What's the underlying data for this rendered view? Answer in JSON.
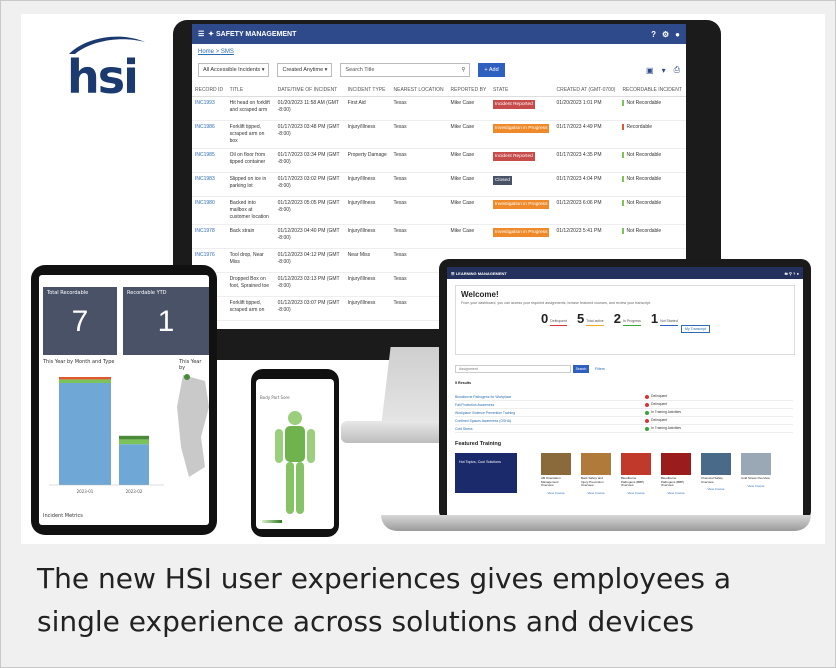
{
  "caption": "The new HSI user experiences gives employees a single experience across solutions and devices",
  "logo": {
    "text": "hsi"
  },
  "colors": {
    "brand_navy": "#1a3a70",
    "header_blue": "#2f4a8a",
    "link_blue": "#2b6cb0",
    "red": "#c84b4b",
    "orange": "#ef8a2a",
    "dark": "#4a5268",
    "green": "#7cc35a"
  },
  "monitor": {
    "app_title": "SAFETY MANAGEMENT",
    "breadcrumb": [
      "Home",
      "SMS"
    ],
    "filter_incidents": "All Accessible Incidents ▾",
    "filter_created": "Created Anytime ▾",
    "search_placeholder": "Search Title",
    "add_label": "+ Add",
    "columns": [
      "RECORD ID",
      "TITLE",
      "DATE/TIME OF INCIDENT",
      "INCIDENT TYPE",
      "NEAREST LOCATION",
      "REPORTED BY",
      "STATE",
      "CREATED AT (GMT-0700)",
      "RECORDABLE INCIDENT"
    ],
    "rows": [
      {
        "id": "INC1993",
        "title": "Hit head on forklift and scraped arm",
        "date": "01/20/2023 11:58 AM (GMT -8:00)",
        "type": "First Aid",
        "loc": "Texas",
        "by": "Mike Case",
        "state": "Incident Reported",
        "state_color": "#c84b4b",
        "created": "01/20/2023 1:01 PM",
        "rec": "Not Recordable"
      },
      {
        "id": "INC1986",
        "title": "Forklift tipped, scraped arm on box",
        "date": "01/17/2023 03:48 PM (GMT -8:00)",
        "type": "Injury/Illness",
        "loc": "Texas",
        "by": "Mike Case",
        "state": "Investigation in Progress",
        "state_color": "#ef8a2a",
        "created": "01/17/2023 4:49 PM",
        "rec": "Recordable"
      },
      {
        "id": "INC1985",
        "title": "Oil on floor from tipped container",
        "date": "01/17/2023 03:34 PM (GMT -8:00)",
        "type": "Property Damage",
        "loc": "Texas",
        "by": "Mike Case",
        "state": "Incident Reported",
        "state_color": "#c84b4b",
        "created": "01/17/2023 4:35 PM",
        "rec": "Not Recordable"
      },
      {
        "id": "INC1983",
        "title": "Slipped on ice in parking lot",
        "date": "01/17/2023 03:02 PM (GMT -8:00)",
        "type": "Injury/Illness",
        "loc": "Texas",
        "by": "Mike Case",
        "state": "Closed",
        "state_color": "#4a5268",
        "created": "01/17/2023 4:04 PM",
        "rec": "Not Recordable"
      },
      {
        "id": "INC1980",
        "title": "Backed into mailbox at customer location",
        "date": "01/12/2023 05:05 PM (GMT -8:00)",
        "type": "Injury/Illness",
        "loc": "Texas",
        "by": "Mike Case",
        "state": "Investigation in Progress",
        "state_color": "#ef8a2a",
        "created": "01/12/2023 6:06 PM",
        "rec": "Not Recordable"
      },
      {
        "id": "INC1978",
        "title": "Back strain",
        "date": "01/12/2023 04:40 PM (GMT -8:00)",
        "type": "Injury/Illness",
        "loc": "Texas",
        "by": "Mike Case",
        "state": "Investigation in Progress",
        "state_color": "#ef8a2a",
        "created": "01/12/2023 5:41 PM",
        "rec": "Not Recordable"
      },
      {
        "id": "INC1976",
        "title": "Tool drop, Near Miss",
        "date": "01/12/2023 04:12 PM (GMT -8:00)",
        "type": "Near Miss",
        "loc": "Texas",
        "by": "",
        "state": "",
        "state_color": "#ffffff",
        "created": "",
        "rec": ""
      },
      {
        "id": "74",
        "title": "Dropped Box on foot, Sprained toe",
        "date": "01/12/2023 03:13 PM (GMT -8:00)",
        "type": "Injury/Illness",
        "loc": "Texas",
        "by": "",
        "state": "",
        "state_color": "#ffffff",
        "created": "",
        "rec": ""
      },
      {
        "id": "73",
        "title": "Forklift tipped, scraped arm on",
        "date": "01/12/2023 03:07 PM (GMT -8:00)",
        "type": "Injury/Illness",
        "loc": "Texas",
        "by": "",
        "state": "",
        "state_color": "#ffffff",
        "created": "",
        "rec": ""
      }
    ]
  },
  "tablet": {
    "tile1_label": "Total Recordable",
    "tile1_value": "7",
    "tile2_label": "Recordable YTD",
    "tile2_value": "1",
    "chart_title": "This Year by Month and Type",
    "chart2_title": "This Year by",
    "footer": "Incident Metrics",
    "bars": [
      {
        "category": "2023-01",
        "segments": [
          {
            "value": 85,
            "color": "#6fa8d6"
          },
          {
            "value": 3,
            "color": "#7cc35a"
          },
          {
            "value": 2,
            "color": "#e3582f"
          }
        ]
      },
      {
        "category": "2023-02",
        "segments": [
          {
            "value": 34,
            "color": "#6fa8d6"
          },
          {
            "value": 4,
            "color": "#7cc35a"
          },
          {
            "value": 3,
            "color": "#4a8a3a"
          }
        ]
      }
    ]
  },
  "phone": {
    "title": "Body Part Sore"
  },
  "laptop": {
    "app_title": "LEARNING MANAGEMENT",
    "welcome_title": "Welcome!",
    "welcome_text": "From your dashboard, you can access your required assignments, browse featured courses, and review your transcript.",
    "stats": [
      {
        "n": "0",
        "label": "Delinquent"
      },
      {
        "n": "5",
        "label": "Total active"
      },
      {
        "n": "2",
        "label": "In Progress"
      },
      {
        "n": "1",
        "label": "Not Started"
      }
    ],
    "transcript_btn": "My Transcript",
    "search_placeholder": "Assignment",
    "search_btn": "Search",
    "filters": "Filters",
    "results": "5 Results",
    "assignments": [
      {
        "title": "Bloodborne Pathogens for Workplace",
        "status": "Delinquent",
        "color": "#d33"
      },
      {
        "title": "Fall Protection Awareness",
        "status": "Delinquent",
        "color": "#d33"
      },
      {
        "title": "Workplace Violence Prevention Training",
        "status": "In Training Activities",
        "color": "#3a3"
      },
      {
        "title": "Confined Spaces Awareness (OSHA)",
        "status": "Delinquent",
        "color": "#d33"
      },
      {
        "title": "Cold Stress",
        "status": "In Training Activities",
        "color": "#3a3"
      }
    ],
    "featured": "Featured Training",
    "course_titles": [
      "Hot Topics, Cool Solutions",
      "AB Orientation Management Overview",
      "Back Safety and Injury Prevention Overview",
      "Bloodborne Pathogens (BBP) Overview",
      "Bloodborne Pathogens (BBP) Overview",
      "Chemical Safety Overview",
      "Cold Stress Overview"
    ],
    "view_course": "View Course"
  }
}
